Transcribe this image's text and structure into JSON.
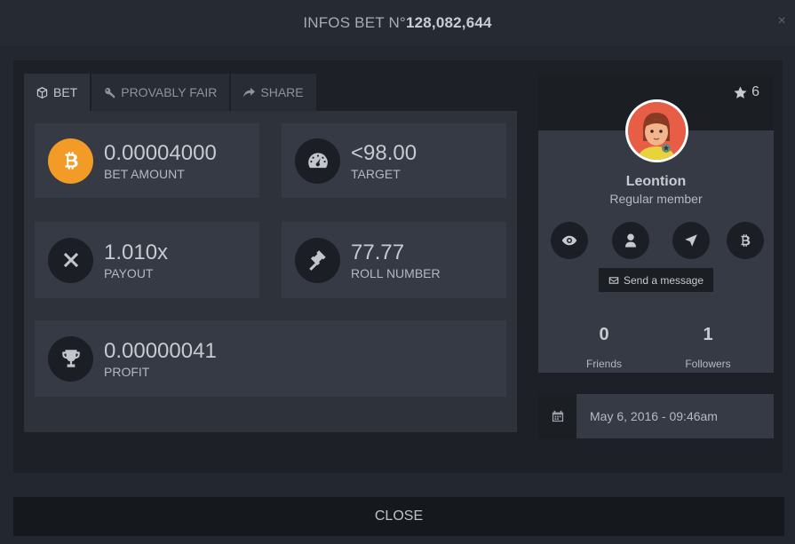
{
  "header": {
    "title_prefix": "INFOS BET N°",
    "bet_number": "128,082,644",
    "close_glyph": "×"
  },
  "tabs": [
    {
      "label": "BET",
      "icon": "cube-icon"
    },
    {
      "label": "PROVABLY FAIR",
      "icon": "key-icon"
    },
    {
      "label": "SHARE",
      "icon": "share-icon"
    }
  ],
  "bet": {
    "bet_amount": {
      "value": "0.00004000",
      "label": "BET AMOUNT"
    },
    "target": {
      "value": "<98.00",
      "label": "TARGET"
    },
    "payout": {
      "value": "1.010x",
      "label": "PAYOUT"
    },
    "roll_number": {
      "value": "77.77",
      "label": "ROLL NUMBER"
    },
    "profit": {
      "value": "0.00000041",
      "label": "PROFIT"
    }
  },
  "profile": {
    "stars": "6",
    "username": "Leontion",
    "rank": "Regular member",
    "send_message": "Send a message",
    "friends_count": "0",
    "friends_label": "Friends",
    "followers_count": "1",
    "followers_label": "Followers"
  },
  "date": "May 6, 2016 - 09:46am",
  "footer": {
    "close_label": "CLOSE"
  },
  "colors": {
    "background": "#232830",
    "panel": "#353a44",
    "dark": "#1b1e24",
    "bitcoin": "#f29b26"
  }
}
